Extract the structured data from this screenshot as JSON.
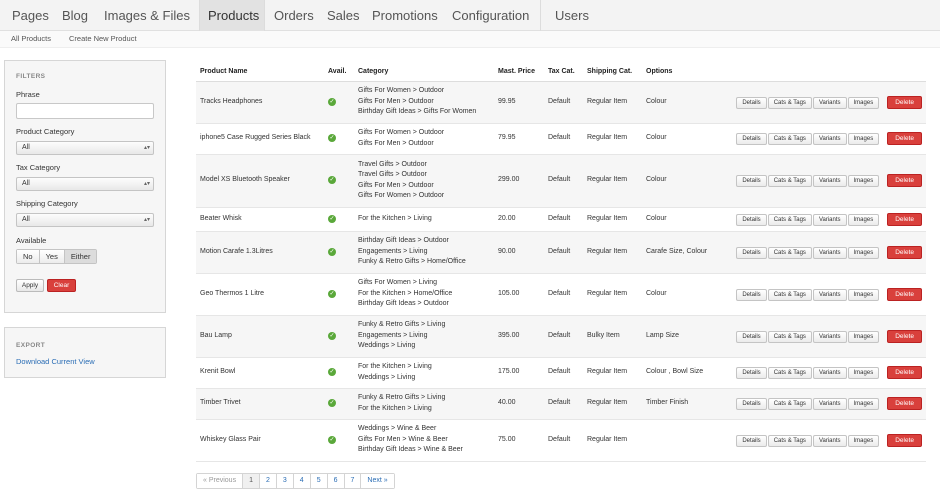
{
  "topnav": {
    "items": [
      {
        "label": "Pages",
        "active": false
      },
      {
        "label": "Blog",
        "active": false
      },
      {
        "label": "Images & Files",
        "active": false
      },
      {
        "label": "Products",
        "active": true
      },
      {
        "label": "Orders",
        "active": false
      },
      {
        "label": "Sales",
        "active": false
      },
      {
        "label": "Promotions",
        "active": false
      },
      {
        "label": "Configuration",
        "active": false
      },
      {
        "label": "Users",
        "active": false
      }
    ]
  },
  "subnav": {
    "links": [
      "All Products",
      "Create New Product"
    ]
  },
  "filters": {
    "title": "FILTERS",
    "phrase_label": "Phrase",
    "phrase_value": "",
    "product_category_label": "Product Category",
    "product_category_value": "All",
    "tax_category_label": "Tax Category",
    "tax_category_value": "All",
    "shipping_category_label": "Shipping Category",
    "shipping_category_value": "All",
    "available_label": "Available",
    "available_options": [
      "No",
      "Yes",
      "Either"
    ],
    "available_selected": "Either",
    "apply_label": "Apply",
    "clear_label": "Clear"
  },
  "export": {
    "title": "EXPORT",
    "link_label": "Download Current View"
  },
  "table": {
    "headers": [
      "Product Name",
      "Avail.",
      "Category",
      "Mast. Price",
      "Tax Cat.",
      "Shipping Cat.",
      "Options"
    ],
    "action_labels": {
      "details": "Details",
      "cats_tags": "Cats & Tags",
      "variants": "Variants",
      "images": "Images",
      "delete": "Delete"
    },
    "rows": [
      {
        "name": "Tracks Headphones",
        "available": true,
        "categories": [
          "Gifts For Women > Outdoor",
          "Gifts For Men > Outdoor",
          "Birthday Gift Ideas > Gifts For Women"
        ],
        "price": "99.95",
        "tax": "Default",
        "shipping": "Regular Item",
        "options": "Colour"
      },
      {
        "name": "iphone5 Case Rugged Series Black",
        "available": true,
        "categories": [
          "Gifts For Women > Outdoor",
          "Gifts For Men > Outdoor"
        ],
        "price": "79.95",
        "tax": "Default",
        "shipping": "Regular Item",
        "options": "Colour"
      },
      {
        "name": "Model XS Bluetooth Speaker",
        "available": true,
        "categories": [
          "Travel Gifts > Outdoor",
          "Travel Gifts > Outdoor",
          "Gifts For Men > Outdoor",
          "Gifts For Women > Outdoor"
        ],
        "price": "299.00",
        "tax": "Default",
        "shipping": "Regular Item",
        "options": "Colour"
      },
      {
        "name": "Beater Whisk",
        "available": true,
        "categories": [
          "For the Kitchen > Living"
        ],
        "price": "20.00",
        "tax": "Default",
        "shipping": "Regular Item",
        "options": "Colour"
      },
      {
        "name": "Motion Carafe 1.3Litres",
        "available": true,
        "categories": [
          "Birthday Gift Ideas > Outdoor",
          "Engagements > Living",
          "Funky & Retro Gifts > Home/Office"
        ],
        "price": "90.00",
        "tax": "Default",
        "shipping": "Regular Item",
        "options": "Carafe Size, Colour"
      },
      {
        "name": "Geo Thermos 1 Litre",
        "available": true,
        "categories": [
          "Gifts For Women > Living",
          "For the Kitchen > Home/Office",
          "Birthday Gift Ideas > Outdoor"
        ],
        "price": "105.00",
        "tax": "Default",
        "shipping": "Regular Item",
        "options": "Colour"
      },
      {
        "name": "Bau Lamp",
        "available": true,
        "categories": [
          "Funky & Retro Gifts > Living",
          "Engagements > Living",
          "Weddings > Living"
        ],
        "price": "395.00",
        "tax": "Default",
        "shipping": "Bulky Item",
        "options": "Lamp Size"
      },
      {
        "name": "Krenit Bowl",
        "available": true,
        "categories": [
          "For the Kitchen > Living",
          "Weddings > Living"
        ],
        "price": "175.00",
        "tax": "Default",
        "shipping": "Regular Item",
        "options": "Colour , Bowl Size"
      },
      {
        "name": "Timber Trivet",
        "available": true,
        "categories": [
          "Funky & Retro Gifts > Living",
          "For the Kitchen > Living"
        ],
        "price": "40.00",
        "tax": "Default",
        "shipping": "Regular Item",
        "options": "Timber Finish"
      },
      {
        "name": "Whiskey Glass Pair",
        "available": true,
        "categories": [
          "Weddings > Wine & Beer",
          "Gifts For Men > Wine & Beer",
          "Birthday Gift Ideas > Wine & Beer"
        ],
        "price": "75.00",
        "tax": "Default",
        "shipping": "Regular Item",
        "options": ""
      }
    ]
  },
  "pagination": {
    "items": [
      "« Previous",
      "1",
      "2",
      "3",
      "4",
      "5",
      "6",
      "7",
      "Next »"
    ],
    "current": "1",
    "disabled": "« Previous"
  },
  "colors": {
    "accent_link": "#2a6db5",
    "delete": "#d9403c",
    "available": "#5aa83a"
  }
}
